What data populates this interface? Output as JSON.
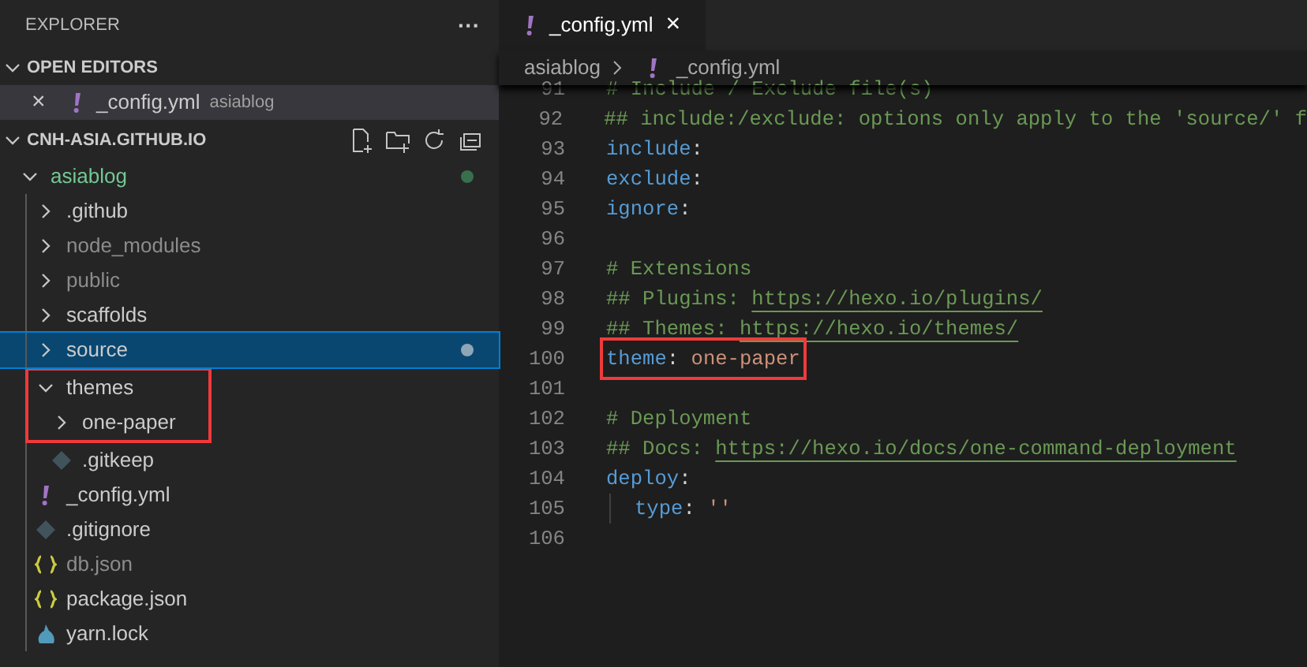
{
  "sidebar": {
    "title": "EXPLORER",
    "more": "···",
    "open_editors": {
      "title": "OPEN EDITORS",
      "expanded": true,
      "items": [
        {
          "close": "×",
          "kind": "yaml",
          "name": "_config.yml",
          "folder": "asiablog",
          "selected": true
        }
      ]
    },
    "workspace": {
      "title": "CNH-ASIA.GITHUB.IO",
      "expanded": true,
      "tree": [
        {
          "name": "asiablog",
          "kind": "folder",
          "expanded": true,
          "modified": true,
          "children": [
            {
              "name": ".github",
              "kind": "folder",
              "expanded": false
            },
            {
              "name": "node_modules",
              "kind": "folder",
              "expanded": false,
              "ignored": true
            },
            {
              "name": "public",
              "kind": "folder",
              "expanded": false,
              "ignored": true
            },
            {
              "name": "scaffolds",
              "kind": "folder",
              "expanded": false
            },
            {
              "name": "source",
              "kind": "folder",
              "expanded": false,
              "selected": true,
              "modified": true
            },
            {
              "name": "themes",
              "kind": "folder",
              "expanded": true,
              "highlighted": true,
              "children": [
                {
                  "name": "one-paper",
                  "kind": "folder",
                  "expanded": false,
                  "highlighted": true
                },
                {
                  "name": ".gitkeep",
                  "kind": "git"
                }
              ]
            },
            {
              "name": "_config.yml",
              "kind": "yaml"
            },
            {
              "name": ".gitignore",
              "kind": "git"
            },
            {
              "name": "db.json",
              "kind": "json",
              "ignored": true
            },
            {
              "name": "package.json",
              "kind": "json"
            },
            {
              "name": "yarn.lock",
              "kind": "yarn"
            }
          ]
        }
      ]
    }
  },
  "editor": {
    "tabs": [
      {
        "kind": "yaml",
        "label": "_config.yml",
        "close": "×",
        "selected": true
      }
    ],
    "breadcrumb": [
      {
        "label": "asiablog"
      },
      {
        "label": "_config.yml",
        "kind": "yaml"
      }
    ],
    "lines": [
      {
        "number": "91",
        "tokens": [
          {
            "kind": "comment",
            "text": "# Include / Exclude file(s)"
          }
        ]
      },
      {
        "number": "92",
        "tokens": [
          {
            "kind": "comment",
            "text": "## include:/exclude: options only apply to the 'source/' f"
          }
        ]
      },
      {
        "number": "93",
        "tokens": [
          {
            "kind": "key",
            "text": "include"
          },
          {
            "kind": "punct",
            "text": ":"
          }
        ]
      },
      {
        "number": "94",
        "tokens": [
          {
            "kind": "key",
            "text": "exclude"
          },
          {
            "kind": "punct",
            "text": ":"
          }
        ]
      },
      {
        "number": "95",
        "tokens": [
          {
            "kind": "key",
            "text": "ignore"
          },
          {
            "kind": "punct",
            "text": ":"
          }
        ]
      },
      {
        "number": "96"
      },
      {
        "number": "97",
        "tokens": [
          {
            "kind": "comment",
            "text": "# Extensions"
          }
        ]
      },
      {
        "number": "98",
        "tokens": [
          {
            "kind": "comment",
            "text": "## Plugins: "
          },
          {
            "kind": "link",
            "text": "https://hexo.io/plugins/"
          }
        ]
      },
      {
        "number": "99",
        "tokens": [
          {
            "kind": "comment",
            "text": "## Themes: "
          },
          {
            "kind": "link",
            "text": "https://hexo.io/themes/"
          }
        ]
      },
      {
        "number": "100",
        "highlighted": true,
        "tokens": [
          {
            "kind": "key",
            "text": "theme"
          },
          {
            "kind": "punct",
            "text": ": "
          },
          {
            "kind": "value",
            "text": "one-paper"
          }
        ]
      },
      {
        "number": "101"
      },
      {
        "number": "102",
        "tokens": [
          {
            "kind": "comment",
            "text": "# Deployment"
          }
        ]
      },
      {
        "number": "103",
        "tokens": [
          {
            "kind": "comment",
            "text": "## Docs: "
          },
          {
            "kind": "link",
            "text": "https://hexo.io/docs/one-command-deployment"
          }
        ]
      },
      {
        "number": "104",
        "tokens": [
          {
            "kind": "key",
            "text": "deploy"
          },
          {
            "kind": "punct",
            "text": ":"
          }
        ]
      },
      {
        "number": "105",
        "indent": true,
        "tokens": [
          {
            "kind": "key",
            "text": "type"
          },
          {
            "kind": "punct",
            "text": ": "
          },
          {
            "kind": "value",
            "text": "''"
          }
        ]
      },
      {
        "number": "106"
      }
    ]
  }
}
